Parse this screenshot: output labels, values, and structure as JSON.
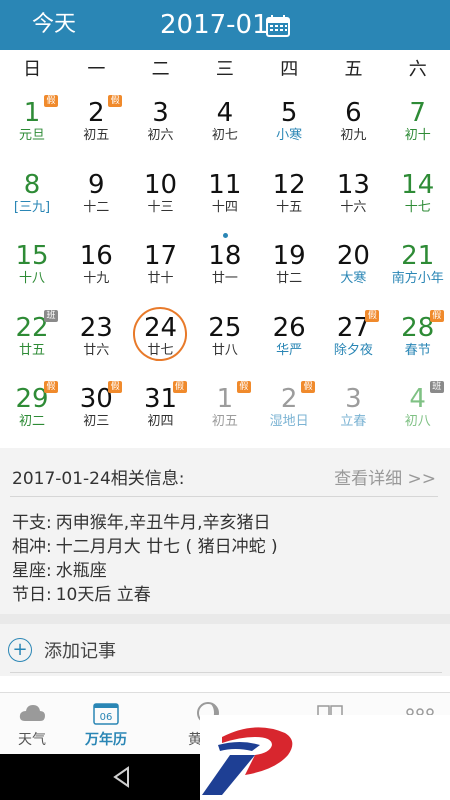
{
  "header": {
    "today_label": "今天",
    "month_title": "2017-01",
    "colors": {
      "bg": "#2a86b5",
      "text": "#ffffff"
    }
  },
  "weekdays": [
    "日",
    "一",
    "二",
    "三",
    "四",
    "五",
    "六"
  ],
  "days": [
    {
      "num": "1",
      "sub": "元旦",
      "style": "green",
      "badge": "假",
      "badge_type": "holiday"
    },
    {
      "num": "2",
      "sub": "初五",
      "style": "",
      "badge": "假",
      "badge_type": "holiday"
    },
    {
      "num": "3",
      "sub": "初六",
      "style": ""
    },
    {
      "num": "4",
      "sub": "初七",
      "style": ""
    },
    {
      "num": "5",
      "sub": "小寒",
      "style": "blue"
    },
    {
      "num": "6",
      "sub": "初九",
      "style": ""
    },
    {
      "num": "7",
      "sub": "初十",
      "style": "green"
    },
    {
      "num": "8",
      "sub": "[三九]",
      "style": "green blue"
    },
    {
      "num": "9",
      "sub": "十二",
      "style": ""
    },
    {
      "num": "10",
      "sub": "十三",
      "style": ""
    },
    {
      "num": "11",
      "sub": "十四",
      "style": ""
    },
    {
      "num": "12",
      "sub": "十五",
      "style": ""
    },
    {
      "num": "13",
      "sub": "十六",
      "style": ""
    },
    {
      "num": "14",
      "sub": "十七",
      "style": "green"
    },
    {
      "num": "15",
      "sub": "十八",
      "style": "green"
    },
    {
      "num": "16",
      "sub": "十九",
      "style": ""
    },
    {
      "num": "17",
      "sub": "廿十",
      "style": ""
    },
    {
      "num": "18",
      "sub": "廿一",
      "style": "",
      "dot": true
    },
    {
      "num": "19",
      "sub": "廿二",
      "style": ""
    },
    {
      "num": "20",
      "sub": "大寒",
      "style": "blue"
    },
    {
      "num": "21",
      "sub": "南方小年",
      "style": "green blue"
    },
    {
      "num": "22",
      "sub": "廿五",
      "style": "green",
      "badge": "班",
      "badge_type": "work"
    },
    {
      "num": "23",
      "sub": "廿六",
      "style": ""
    },
    {
      "num": "24",
      "sub": "廿七",
      "style": "",
      "selected": true
    },
    {
      "num": "25",
      "sub": "廿八",
      "style": ""
    },
    {
      "num": "26",
      "sub": "华严",
      "style": "blue"
    },
    {
      "num": "27",
      "sub": "除夕夜",
      "style": "blue",
      "badge": "假",
      "badge_type": "holiday"
    },
    {
      "num": "28",
      "sub": "春节",
      "style": "green blue",
      "badge": "假",
      "badge_type": "holiday"
    },
    {
      "num": "29",
      "sub": "初二",
      "style": "green",
      "badge": "假",
      "badge_type": "holiday"
    },
    {
      "num": "30",
      "sub": "初三",
      "style": "",
      "badge": "假",
      "badge_type": "holiday"
    },
    {
      "num": "31",
      "sub": "初四",
      "style": "",
      "badge": "假",
      "badge_type": "holiday"
    },
    {
      "num": "1",
      "sub": "初五",
      "style": "dim",
      "badge": "假",
      "badge_type": "holiday"
    },
    {
      "num": "2",
      "sub": "湿地日",
      "style": "dim blue",
      "badge": "假",
      "badge_type": "holiday"
    },
    {
      "num": "3",
      "sub": "立春",
      "style": "dim blue"
    },
    {
      "num": "4",
      "sub": "初八",
      "style": "dim green",
      "badge": "班",
      "badge_type": "work"
    }
  ],
  "info": {
    "heading": "2017-01-24相关信息:",
    "detail_link": "查看详细 >>",
    "rows": [
      {
        "label": "干支:",
        "value": "丙申猴年,辛丑牛月,辛亥猪日"
      },
      {
        "label": "相冲:",
        "value": "十二月月大 廿七 ( 猪日冲蛇 )"
      },
      {
        "label": "星座:",
        "value": "水瓶座"
      },
      {
        "label": "节日:",
        "value": "10天后 立春"
      }
    ]
  },
  "add_note": {
    "icon": "+",
    "label": "添加记事"
  },
  "tabs": [
    {
      "label": "天气",
      "icon": "cloud-icon",
      "active": false
    },
    {
      "label": "万年历",
      "icon": "calendar-icon",
      "active": true,
      "icon_text": "06"
    },
    {
      "label": "黄",
      "icon": "moon-icon",
      "active": false
    }
  ],
  "colors": {
    "accent": "#2a86b5",
    "holiday": "#f08a2c",
    "weekend_green": "#2e8b36",
    "selection": "#e87a2a"
  }
}
